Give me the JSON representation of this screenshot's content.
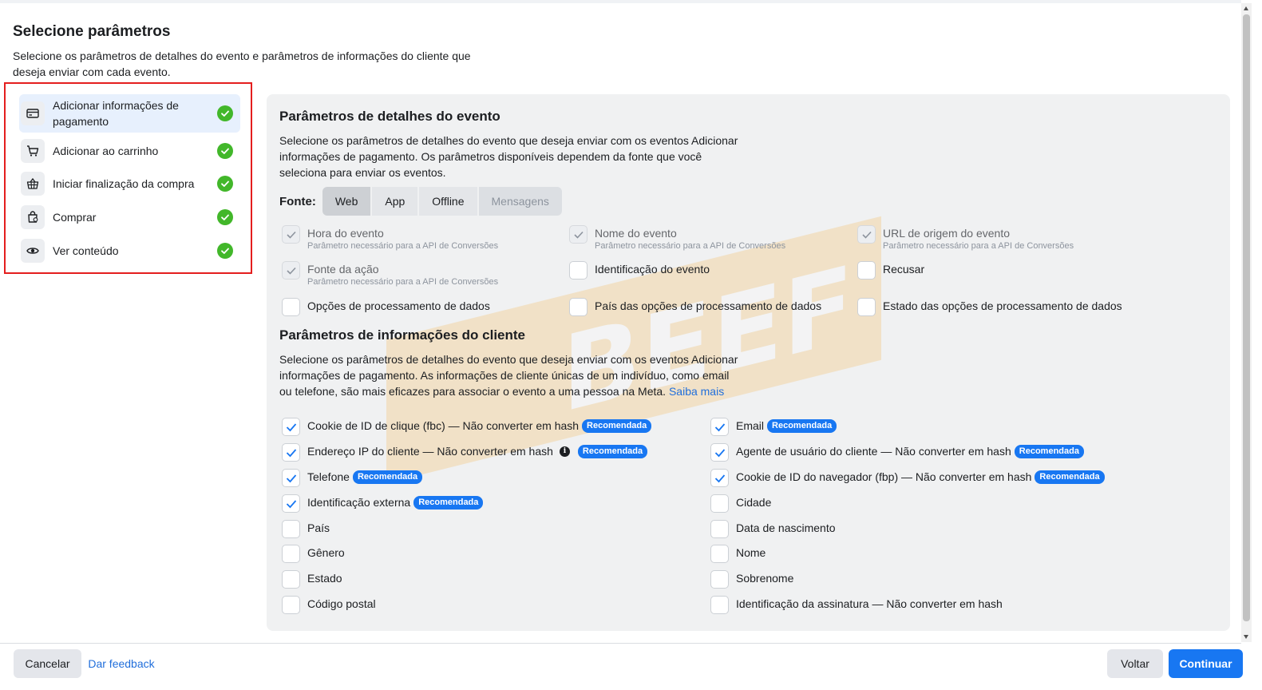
{
  "header": {
    "title": "Selecione parâmetros",
    "subtitle": "Selecione os parâmetros de detalhes do evento e parâmetros de informações do cliente que deseja enviar com cada evento."
  },
  "events": [
    {
      "label": "Adicionar informações de pagamento",
      "icon": "credit-card-icon",
      "active": true
    },
    {
      "label": "Adicionar ao carrinho",
      "icon": "cart-icon",
      "active": false
    },
    {
      "label": "Iniciar finalização da compra",
      "icon": "basket-icon",
      "active": false
    },
    {
      "label": "Comprar",
      "icon": "bag-icon",
      "active": false
    },
    {
      "label": "Ver conteúdo",
      "icon": "eye-icon",
      "active": false
    }
  ],
  "event_details": {
    "title": "Parâmetros de detalhes do evento",
    "description": "Selecione os parâmetros de detalhes do evento que deseja enviar com os eventos Adicionar informações de pagamento. Os parâmetros disponíveis dependem da fonte que você seleciona para enviar os eventos.",
    "source_label": "Fonte:",
    "sources": [
      "Web",
      "App",
      "Offline",
      "Mensagens"
    ],
    "selected_source": "Web",
    "required_note": "Parâmetro necessário para a API de Conversões",
    "params": [
      {
        "label": "Hora do evento",
        "checked": true,
        "disabled": true,
        "note": "Parâmetro necessário para a API de Conversões"
      },
      {
        "label": "Nome do evento",
        "checked": true,
        "disabled": true,
        "note": "Parâmetro necessário para a API de Conversões"
      },
      {
        "label": "URL de origem do evento",
        "checked": true,
        "disabled": true,
        "note": "Parâmetro necessário para a API de Conversões"
      },
      {
        "label": "Fonte da ação",
        "checked": true,
        "disabled": true,
        "note": "Parâmetro necessário para a API de Conversões"
      },
      {
        "label": "Identificação do evento",
        "checked": false,
        "disabled": false,
        "note": ""
      },
      {
        "label": "Recusar",
        "checked": false,
        "disabled": false,
        "note": ""
      },
      {
        "label": "Opções de processamento de dados",
        "checked": false,
        "disabled": false,
        "note": ""
      },
      {
        "label": "País das opções de processamento de dados",
        "checked": false,
        "disabled": false,
        "note": ""
      },
      {
        "label": "Estado das opções de processamento de dados",
        "checked": false,
        "disabled": false,
        "note": ""
      }
    ]
  },
  "customer_info": {
    "title": "Parâmetros de informações do cliente",
    "description": "Selecione os parâmetros de detalhes do evento que deseja enviar com os eventos Adicionar informações de pagamento. As informações de cliente únicas de um indivíduo, como email ou telefone, são mais eficazes para associar o evento a uma pessoa na Meta.",
    "learn_more": "Saiba mais",
    "badge": "Recomendada",
    "left_params": [
      {
        "label": "Cookie de ID de clique (fbc) — Não converter em hash",
        "checked": true,
        "badge": true,
        "info": false
      },
      {
        "label": "Endereço IP do cliente — Não converter em hash",
        "checked": true,
        "badge": true,
        "info": true
      },
      {
        "label": "Telefone",
        "checked": true,
        "badge": true,
        "info": false
      },
      {
        "label": "Identificação externa",
        "checked": true,
        "badge": true,
        "info": false
      },
      {
        "label": "País",
        "checked": false,
        "badge": false,
        "info": false
      },
      {
        "label": "Gênero",
        "checked": false,
        "badge": false,
        "info": false
      },
      {
        "label": "Estado",
        "checked": false,
        "badge": false,
        "info": false
      },
      {
        "label": "Código postal",
        "checked": false,
        "badge": false,
        "info": false
      }
    ],
    "right_params": [
      {
        "label": "Email",
        "checked": true,
        "badge": true,
        "info": false
      },
      {
        "label": "Agente de usuário do cliente — Não converter em hash",
        "checked": true,
        "badge": true,
        "info": false
      },
      {
        "label": "Cookie de ID do navegador (fbp) — Não converter em hash",
        "checked": true,
        "badge": true,
        "info": false
      },
      {
        "label": "Cidade",
        "checked": false,
        "badge": false,
        "info": false
      },
      {
        "label": "Data de nascimento",
        "checked": false,
        "badge": false,
        "info": false
      },
      {
        "label": "Nome",
        "checked": false,
        "badge": false,
        "info": false
      },
      {
        "label": "Sobrenome",
        "checked": false,
        "badge": false,
        "info": false
      },
      {
        "label": "Identificação da assinatura — Não converter em hash",
        "checked": false,
        "badge": false,
        "info": false
      }
    ]
  },
  "footer": {
    "cancel": "Cancelar",
    "feedback": "Dar feedback",
    "back": "Voltar",
    "continue": "Continuar"
  },
  "colors": {
    "accent": "#1877f2",
    "success": "#42b72a",
    "highlight_frame": "#e41e1e",
    "panel_bg": "#f0f1f2"
  }
}
